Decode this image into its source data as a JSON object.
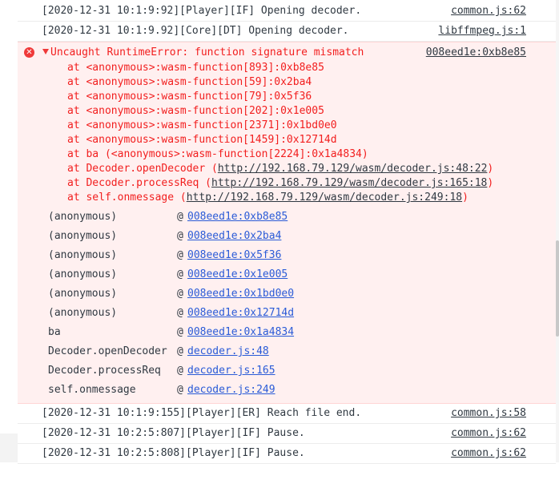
{
  "logs_top": [
    {
      "message": "[2020-12-31 10:1:9:92][Player][IF] Opening decoder.",
      "source": "common.js:62"
    },
    {
      "message": "[2020-12-31 10:1:9.92][Core][DT] Opening decoder.",
      "source": "libffmpeg.js:1"
    }
  ],
  "error": {
    "icon": "error-circle-icon",
    "title": "Uncaught RuntimeError: function signature mismatch",
    "source": "008eed1e:0xb8e85",
    "stack_lines": [
      {
        "text": "at <anonymous>:wasm-function[893]:0xb8e85",
        "url": ""
      },
      {
        "text": "at <anonymous>:wasm-function[59]:0x2ba4",
        "url": ""
      },
      {
        "text": "at <anonymous>:wasm-function[79]:0x5f36",
        "url": ""
      },
      {
        "text": "at <anonymous>:wasm-function[202]:0x1e005",
        "url": ""
      },
      {
        "text": "at <anonymous>:wasm-function[2371]:0x1bd0e0",
        "url": ""
      },
      {
        "text": "at <anonymous>:wasm-function[1459]:0x12714d",
        "url": ""
      },
      {
        "text": "at ba (<anonymous>:wasm-function[2224]:0x1a4834)",
        "url": ""
      },
      {
        "text": "at Decoder.openDecoder (",
        "url": "http://192.168.79.129/wasm/decoder.js:48:22",
        "suffix": ")"
      },
      {
        "text": "at Decoder.processReq (",
        "url": "http://192.168.79.129/wasm/decoder.js:165:18",
        "suffix": ")"
      },
      {
        "text": "at self.onmessage (",
        "url": "http://192.168.79.129/wasm/decoder.js:249:18",
        "suffix": ")"
      }
    ],
    "frames": [
      {
        "fn": "(anonymous)",
        "at": "@",
        "loc": "008eed1e:0xb8e85"
      },
      {
        "fn": "(anonymous)",
        "at": "@",
        "loc": "008eed1e:0x2ba4"
      },
      {
        "fn": "(anonymous)",
        "at": "@",
        "loc": "008eed1e:0x5f36"
      },
      {
        "fn": "(anonymous)",
        "at": "@",
        "loc": "008eed1e:0x1e005"
      },
      {
        "fn": "(anonymous)",
        "at": "@",
        "loc": "008eed1e:0x1bd0e0"
      },
      {
        "fn": "(anonymous)",
        "at": "@",
        "loc": "008eed1e:0x12714d"
      },
      {
        "fn": "ba",
        "at": "@",
        "loc": "008eed1e:0x1a4834"
      },
      {
        "fn": "Decoder.openDecoder",
        "at": "@",
        "loc": "decoder.js:48"
      },
      {
        "fn": "Decoder.processReq",
        "at": "@",
        "loc": "decoder.js:165"
      },
      {
        "fn": "self.onmessage",
        "at": "@",
        "loc": "decoder.js:249"
      }
    ]
  },
  "logs_bottom": [
    {
      "message": "[2020-12-31 10:1:9:155][Player][ER] Reach file end.",
      "source": "common.js:58"
    },
    {
      "message": "[2020-12-31 10:2:5:807][Player][IF] Pause.",
      "source": "common.js:62"
    },
    {
      "message": "[2020-12-31 10:2:5:808][Player][IF] Pause.",
      "source": "common.js:62"
    }
  ],
  "colors": {
    "error_text": "#f21e1e",
    "error_bg": "#fff0f0",
    "link": "#2a5bd7"
  }
}
